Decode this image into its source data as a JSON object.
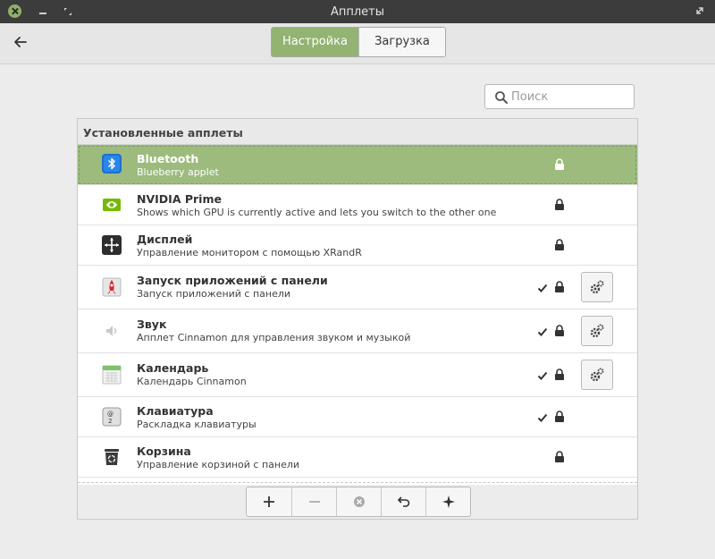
{
  "window": {
    "title": "Апплеты"
  },
  "tabs": [
    {
      "label": "Настройка",
      "active": true
    },
    {
      "label": "Загрузка",
      "active": false
    }
  ],
  "search": {
    "placeholder": "Поиск",
    "value": ""
  },
  "panel": {
    "title": "Установленные апплеты"
  },
  "applets": [
    {
      "name": "Bluetooth",
      "desc": "Blueberry applet",
      "icon": "bluetooth-icon",
      "selected": true,
      "active": false,
      "locked": true,
      "configurable": false
    },
    {
      "name": "NVIDIA Prime",
      "desc": "Shows which GPU is currently active and lets you switch to the other one",
      "icon": "nvidia-icon",
      "selected": false,
      "active": false,
      "locked": true,
      "configurable": false
    },
    {
      "name": "Дисплей",
      "desc": "Управление монитором с помощью XRandR",
      "icon": "display-icon",
      "selected": false,
      "active": false,
      "locked": true,
      "configurable": false
    },
    {
      "name": "Запуск приложений с панели",
      "desc": "Запуск приложений с панели",
      "icon": "launcher-icon",
      "selected": false,
      "active": true,
      "locked": true,
      "configurable": true
    },
    {
      "name": "Звук",
      "desc": "Апплет Cinnamon для управления звуком и музыкой",
      "icon": "speaker-icon",
      "selected": false,
      "active": true,
      "locked": true,
      "configurable": true
    },
    {
      "name": "Календарь",
      "desc": "Календарь Cinnamon",
      "icon": "calendar-icon",
      "selected": false,
      "active": true,
      "locked": true,
      "configurable": true
    },
    {
      "name": "Клавиатура",
      "desc": "Раскладка клавиатуры",
      "icon": "keyboard-icon",
      "selected": false,
      "active": true,
      "locked": true,
      "configurable": false
    },
    {
      "name": "Корзина",
      "desc": "Управление корзиной с панели",
      "icon": "trash-icon",
      "selected": false,
      "active": false,
      "locked": true,
      "configurable": false
    }
  ],
  "toolbar": [
    {
      "action": "add",
      "icon": "plus-icon"
    },
    {
      "action": "remove",
      "icon": "minus-icon"
    },
    {
      "action": "clear",
      "icon": "clear-icon"
    },
    {
      "action": "undo",
      "icon": "undo-icon"
    },
    {
      "action": "more",
      "icon": "star-icon"
    }
  ],
  "colors": {
    "accent": "#92b372",
    "titlebar": "#3c3c3c"
  }
}
